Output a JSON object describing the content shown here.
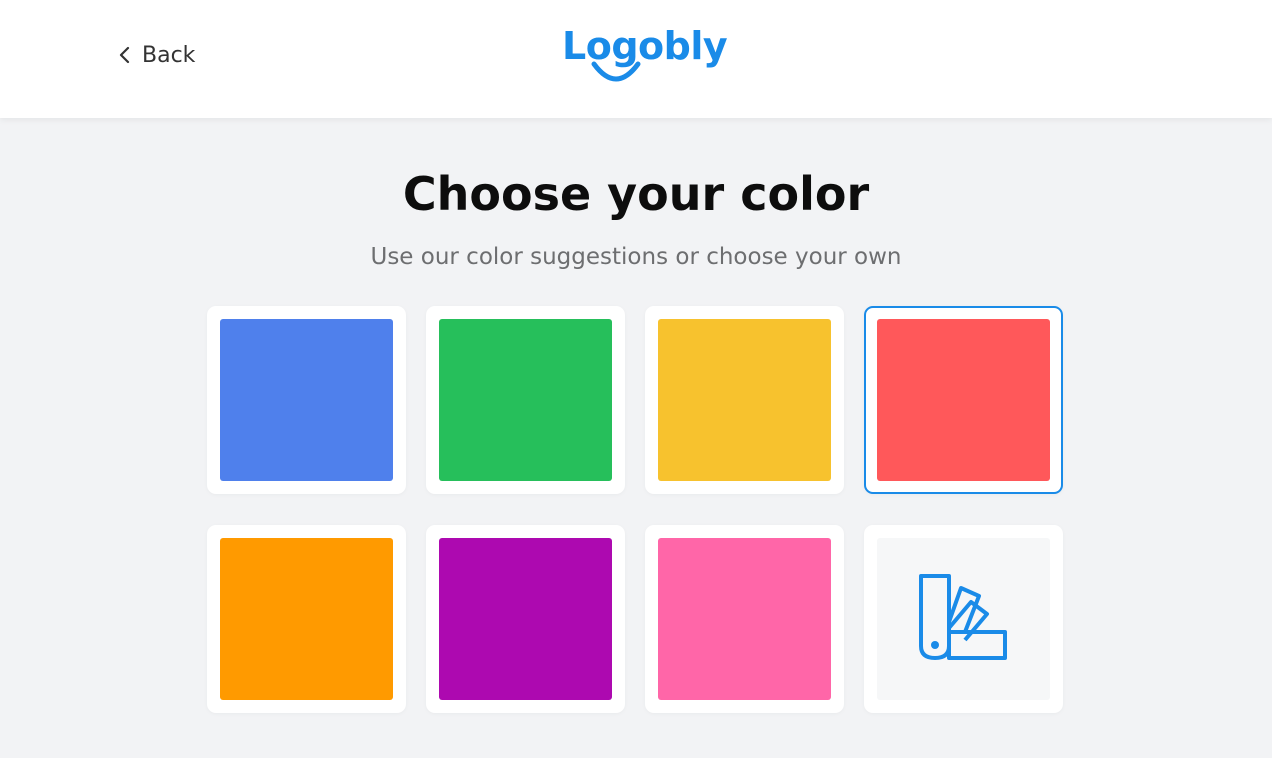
{
  "header": {
    "back_label": "Back",
    "logo_text": "Logobly",
    "brand_color": "#1a8be8"
  },
  "main": {
    "title": "Choose your color",
    "subtitle": "Use our color suggestions or choose your own",
    "selected_index": 3,
    "swatches": [
      {
        "name": "blue",
        "color": "#4f80ec"
      },
      {
        "name": "green",
        "color": "#26bf5b"
      },
      {
        "name": "yellow",
        "color": "#f7c22e"
      },
      {
        "name": "red",
        "color": "#ff585a"
      },
      {
        "name": "orange",
        "color": "#ff9a00"
      },
      {
        "name": "purple",
        "color": "#ad09b0"
      },
      {
        "name": "pink",
        "color": "#ff66a8"
      }
    ],
    "custom_color_icon": "color-palette-icon"
  }
}
